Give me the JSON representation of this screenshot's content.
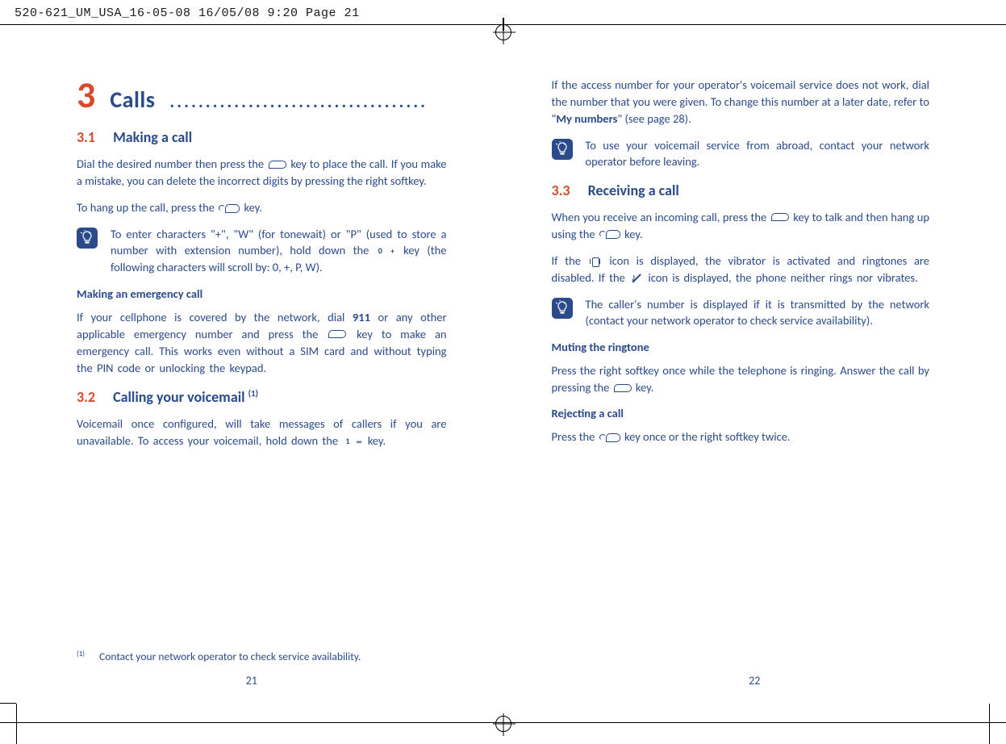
{
  "print_header": "520-621_UM_USA_16-05-08  16/05/08  9:20  Page 21",
  "chapter": {
    "num": "3",
    "title": "Calls"
  },
  "page_left": {
    "num": "21",
    "sections": {
      "s31": {
        "num": "3.1",
        "title": "Making a call"
      },
      "s32": {
        "num": "3.2",
        "title": "Calling your voicemail ",
        "sup": "(1)"
      }
    },
    "p1a": "Dial the desired number then press the ",
    "p1b": " key to place the call. If you make a mistake, you can delete the incorrect digits by pressing the right softkey.",
    "p2a": "To hang up the call, press the ",
    "p2b": " key.",
    "tip1a": "To enter characters \"+\", \"W\" (for tonewait) or \"P\" (used to store a number with extension number), hold down the ",
    "tip1b": " key (the following characters will scroll by: 0, +, P, W).",
    "sub1": "Making an emergency call",
    "p3a": "If your cellphone is covered by the network, dial ",
    "p3_bold": "911",
    "p3b": " or any other applicable emergency number and press the ",
    "p3c": " key to make an emergency call.  This works even without a SIM card and without typing the PIN code or unlocking the keypad.",
    "p4a": "Voicemail once configured, will take messages of callers if you are unavailable.  To access your voicemail, hold down the ",
    "p4b": " key.",
    "footnote": {
      "mark": "(1)",
      "text": "Contact your network operator to check service availability."
    }
  },
  "page_right": {
    "num": "22",
    "p1a": "If the access number for your operator's voicemail service does not work, dial the number that you were given. To change this number at a later date, refer to \"",
    "p1_bold": "My numbers",
    "p1b": "\" (see page 28).",
    "tip1": "To use your voicemail service from abroad, contact your network operator before leaving.",
    "sections": {
      "s33": {
        "num": "3.3",
        "title": "Receiving a call"
      }
    },
    "p2a": "When you receive an incoming call, press the ",
    "p2b": " key to talk and then hang up using the ",
    "p2c": " key.",
    "p3a": "If the ",
    "p3b": " icon is displayed, the vibrator is activated and ringtones are disabled. If the ",
    "p3c": " icon is displayed, the phone neither rings nor vibrates.",
    "tip2": "The caller's number is displayed if it is transmitted by the network (contact your network operator to check service availability).",
    "sub1": "Muting the ringtone",
    "p4a": "Press the right softkey once while the telephone is ringing.  Answer the call by pressing the ",
    "p4b": " key.",
    "sub2": "Rejecting a call",
    "p5a": "Press the ",
    "p5b": " key once or the right softkey twice."
  }
}
